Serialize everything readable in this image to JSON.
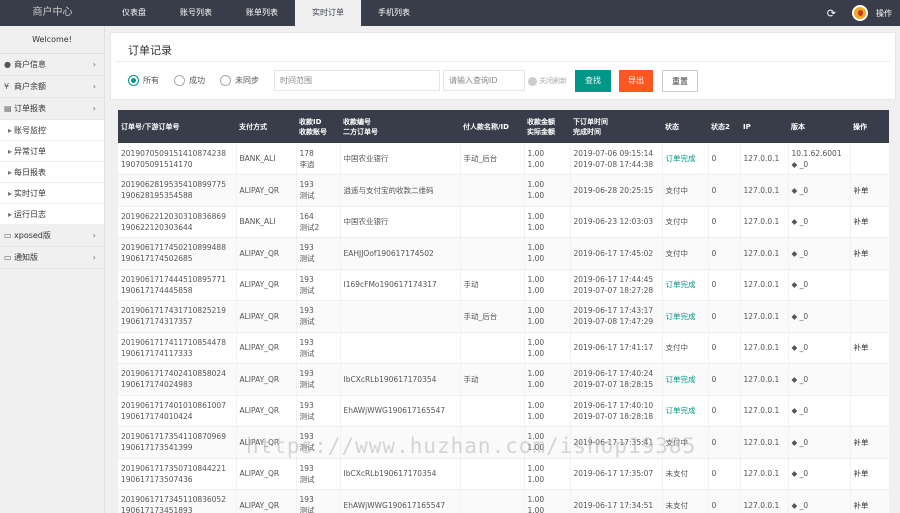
{
  "brand": "商户中心",
  "nav": [
    "仪表盘",
    "账号列表",
    "账单列表",
    "实时订单",
    "手机列表"
  ],
  "topright": {
    "operate": "操作"
  },
  "sidebar": {
    "welcome": "Welcome!",
    "menus": [
      {
        "label": "商户信息"
      },
      {
        "label": "商户余额"
      },
      {
        "label": "订单报表"
      }
    ],
    "subs": [
      "账号监控",
      "异常订单",
      "每日报表",
      "实时订单",
      "运行日志"
    ],
    "menus2": [
      {
        "label": "xposed版"
      },
      {
        "label": "通知版"
      }
    ]
  },
  "filter": {
    "title": "订单记录",
    "radios": [
      "所有",
      "成功",
      "未同步"
    ],
    "time_placeholder": "时间范围",
    "id_placeholder": "请输入查询ID",
    "auto_refresh": "关闭刷新",
    "search_btn": "查找",
    "export_btn": "导出",
    "reset_btn": "重置"
  },
  "table": {
    "headers": [
      [
        "订单号/下游订单号"
      ],
      [
        "支付方式"
      ],
      [
        "收款ID",
        "收款账号"
      ],
      [
        "收款编号",
        "二方订单号"
      ],
      [
        "付人款名称/ID"
      ],
      [
        "收款金额",
        "实际金额"
      ],
      [
        "下订单时间",
        "完成时间"
      ],
      [
        "状态"
      ],
      [
        "状态2"
      ],
      [
        "IP"
      ],
      [
        "版本"
      ],
      [
        "操作"
      ]
    ],
    "rows": [
      {
        "order": "2019070509151410874238",
        "down": "190705091514170",
        "pay": "BANK_ALI",
        "rid": "178",
        "racc": "李逍",
        "no": "中国农业银行",
        "tno": "",
        "payer": "手动_后台",
        "amt": "1.00",
        "real": "1.00",
        "t1": "2019-07-06 09:15:14",
        "t2": "2019-07-08 17:44:38",
        "status": "订单完成",
        "s2": "0",
        "ip": "127.0.0.1",
        "ver": "10.1.62.6001",
        "ver2": "◆ _0",
        "op": ""
      },
      {
        "order": "2019062819535410899775",
        "down": "190628195354588",
        "pay": "ALIPAY_QR",
        "rid": "193",
        "racc": "测试",
        "no": "逍遥与支付宝的收款二维码",
        "tno": "",
        "payer": "",
        "amt": "1.00",
        "real": "1.00",
        "t1": "2019-06-28 20:25:15",
        "t2": "",
        "status": "支付中",
        "s2": "0",
        "ip": "127.0.0.1",
        "ver": "",
        "ver2": "◆ _0",
        "op": "补单"
      },
      {
        "order": "2019062212030310836869",
        "down": "190622120303644",
        "pay": "BANK_ALI",
        "rid": "164",
        "racc": "测试2",
        "no": "中国农业银行",
        "tno": "",
        "payer": "",
        "amt": "1.00",
        "real": "1.00",
        "t1": "2019-06-23 12:03:03",
        "t2": "",
        "status": "支付中",
        "s2": "0",
        "ip": "127.0.0.1",
        "ver": "",
        "ver2": "◆ _0",
        "op": "补单"
      },
      {
        "order": "2019061717450210899488",
        "down": "190617174502685",
        "pay": "ALIPAY_QR",
        "rid": "193",
        "racc": "测试",
        "no": "",
        "tno": "EAHJJOof190617174502",
        "payer": "",
        "amt": "1.00",
        "real": "1.00",
        "t1": "2019-06-17 17:45:02",
        "t2": "",
        "status": "支付中",
        "s2": "0",
        "ip": "127.0.0.1",
        "ver": "",
        "ver2": "◆ _0",
        "op": "补单"
      },
      {
        "order": "2019061717444510895771",
        "down": "190617174445858",
        "pay": "ALIPAY_QR",
        "rid": "193",
        "racc": "测试",
        "no": "",
        "tno": "I169cFMo190617174317",
        "payer": "手动",
        "amt": "1.00",
        "real": "1.00",
        "t1": "2019-06-17 17:44:45",
        "t2": "2019-07-07 18:27:28",
        "status": "订单完成",
        "s2": "0",
        "ip": "127.0.0.1",
        "ver": "",
        "ver2": "◆ _0",
        "op": ""
      },
      {
        "order": "2019061717431710825219",
        "down": "190617174317357",
        "pay": "ALIPAY_QR",
        "rid": "193",
        "racc": "测试",
        "no": "",
        "tno": "",
        "payer": "手动_后台",
        "amt": "1.00",
        "real": "1.00",
        "t1": "2019-06-17 17:43:17",
        "t2": "2019-07-08 17:47:29",
        "status": "订单完成",
        "s2": "0",
        "ip": "127.0.0.1",
        "ver": "",
        "ver2": "◆ _0",
        "op": ""
      },
      {
        "order": "2019061717411710854478",
        "down": "190617174117333",
        "pay": "ALIPAY_QR",
        "rid": "193",
        "racc": "测试",
        "no": "",
        "tno": "",
        "payer": "",
        "amt": "1.00",
        "real": "1.00",
        "t1": "2019-06-17 17:41:17",
        "t2": "",
        "status": "支付中",
        "s2": "0",
        "ip": "127.0.0.1",
        "ver": "",
        "ver2": "◆ _0",
        "op": "补单"
      },
      {
        "order": "2019061717402410858024",
        "down": "190617174024983",
        "pay": "ALIPAY_QR",
        "rid": "193",
        "racc": "测试",
        "no": "",
        "tno": "IbCXcRLb190617170354",
        "payer": "手动",
        "amt": "1.00",
        "real": "1.00",
        "t1": "2019-06-17 17:40:24",
        "t2": "2019-07-07 18:28:15",
        "status": "订单完成",
        "s2": "0",
        "ip": "127.0.0.1",
        "ver": "",
        "ver2": "◆ _0",
        "op": ""
      },
      {
        "order": "2019061717401010861007",
        "down": "190617174010424",
        "pay": "ALIPAY_QR",
        "rid": "193",
        "racc": "测试",
        "no": "",
        "tno": "EhAWjWWG190617165547",
        "payer": "",
        "amt": "1.00",
        "real": "1.00",
        "t1": "2019-06-17 17:40:10",
        "t2": "2019-07-07 18:28:18",
        "status": "订单完成",
        "s2": "0",
        "ip": "127.0.0.1",
        "ver": "",
        "ver2": "◆ _0",
        "op": ""
      },
      {
        "order": "2019061717354110870969",
        "down": "190617173541399",
        "pay": "ALIPAY_QR",
        "rid": "193",
        "racc": "测试",
        "no": "",
        "tno": "",
        "payer": "",
        "amt": "1.00",
        "real": "1.00",
        "t1": "2019-06-17 17:35:41",
        "t2": "",
        "status": "支付中",
        "s2": "0",
        "ip": "127.0.0.1",
        "ver": "",
        "ver2": "◆ _0",
        "op": "补单"
      },
      {
        "order": "2019061717350710844221",
        "down": "190617173507436",
        "pay": "ALIPAY_QR",
        "rid": "193",
        "racc": "测试",
        "no": "",
        "tno": "IbCXcRLb190617170354",
        "payer": "",
        "amt": "1.00",
        "real": "1.00",
        "t1": "2019-06-17 17:35:07",
        "t2": "",
        "status": "未支付",
        "s2": "0",
        "ip": "127.0.0.1",
        "ver": "",
        "ver2": "◆ _0",
        "op": "补单"
      },
      {
        "order": "2019061717345110836052",
        "down": "190617173451893",
        "pay": "ALIPAY_QR",
        "rid": "193",
        "racc": "测试",
        "no": "",
        "tno": "EhAWjWWG190617165547",
        "payer": "",
        "amt": "1.00",
        "real": "1.00",
        "t1": "2019-06-17 17:34:51",
        "t2": "",
        "status": "未支付",
        "s2": "0",
        "ip": "127.0.0.1",
        "ver": "",
        "ver2": "◆ _0",
        "op": "补单"
      }
    ]
  },
  "watermark": "https://www.huzhan.com/ishop19385",
  "colors": {
    "topbar": "#393d49",
    "accent": "#009688",
    "export": "#ff5722"
  }
}
